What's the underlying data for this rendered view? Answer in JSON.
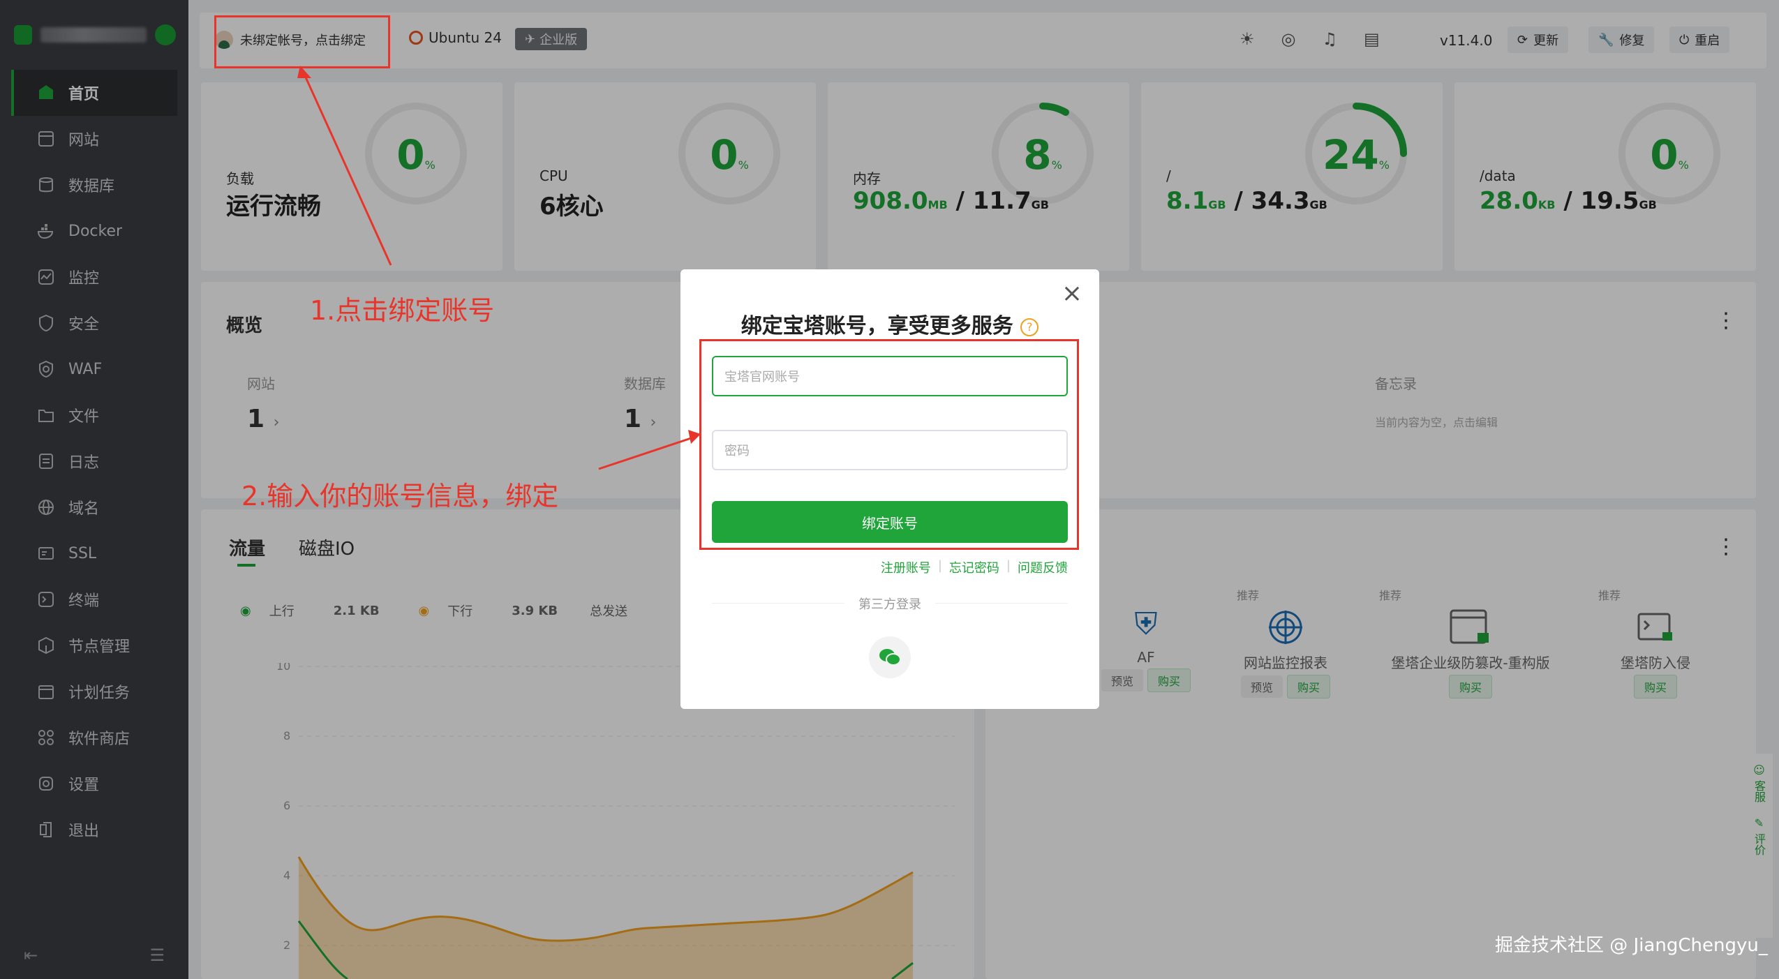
{
  "sidebar": {
    "items": [
      {
        "label": "首页",
        "icon": "home-icon"
      },
      {
        "label": "网站",
        "icon": "website-icon"
      },
      {
        "label": "数据库",
        "icon": "database-icon"
      },
      {
        "label": "Docker",
        "icon": "docker-icon"
      },
      {
        "label": "监控",
        "icon": "monitor-icon"
      },
      {
        "label": "安全",
        "icon": "shield-icon"
      },
      {
        "label": "WAF",
        "icon": "waf-icon"
      },
      {
        "label": "文件",
        "icon": "folder-icon"
      },
      {
        "label": "日志",
        "icon": "log-icon"
      },
      {
        "label": "域名",
        "icon": "globe-icon"
      },
      {
        "label": "SSL",
        "icon": "ssl-icon"
      },
      {
        "label": "终端",
        "icon": "terminal-icon"
      },
      {
        "label": "节点管理",
        "icon": "node-icon"
      },
      {
        "label": "计划任务",
        "icon": "calendar-icon"
      },
      {
        "label": "软件商店",
        "icon": "store-icon"
      },
      {
        "label": "设置",
        "icon": "gear-icon"
      },
      {
        "label": "退出",
        "icon": "logout-icon"
      }
    ]
  },
  "topbar": {
    "bind_tip": "未绑定帐号，点击绑定",
    "os": "Ubuntu 24",
    "edition": "企业版",
    "version": "v11.4.0",
    "update": "更新",
    "repair": "修复",
    "restart": "重启"
  },
  "stats": [
    {
      "label": "负载",
      "value": "运行流畅",
      "percent": "0"
    },
    {
      "label": "CPU",
      "value": "6核心",
      "percent": "0"
    },
    {
      "label": "内存",
      "used": "908.0",
      "used_unit": "MB",
      "total": "11.7",
      "total_unit": "GB",
      "percent": "8"
    },
    {
      "label": "/",
      "used": "8.1",
      "used_unit": "GB",
      "total": "34.3",
      "total_unit": "GB",
      "percent": "24"
    },
    {
      "label": "/data",
      "used": "28.0",
      "used_unit": "KB",
      "total": "19.5",
      "total_unit": "GB",
      "percent": "0"
    }
  ],
  "overview": {
    "title": "概览",
    "site_label": "网站",
    "site_count": "1",
    "db_label": "数据库",
    "db_count": "1",
    "memo_label": "备忘录",
    "memo_hint": "当前内容为空，点击编辑"
  },
  "traffic": {
    "tab1": "流量",
    "tab2": "磁盘IO",
    "up_label": "上行",
    "up_value": "2.1 KB",
    "down_label": "下行",
    "down_value": "3.9 KB",
    "total_send": "总发送",
    "y_ticks": [
      "10",
      "8",
      "6",
      "4",
      "2"
    ]
  },
  "apps": {
    "recommend": "推荐",
    "preview": "预览",
    "buy": "购买",
    "items": [
      "AF",
      "网站监控报表",
      "堡塔企业级防篡改-重构版",
      "堡塔防入侵"
    ]
  },
  "modal": {
    "title": "绑定宝塔账号，享受更多服务",
    "account_placeholder": "宝塔官网账号",
    "password_placeholder": "密码",
    "bind_button": "绑定账号",
    "link_register": "注册账号",
    "link_forgot": "忘记密码",
    "link_feedback": "问题反馈",
    "third_party": "第三方登录"
  },
  "annotations": {
    "step1": "1.点击绑定账号",
    "step2": "2.输入你的账号信息，绑定"
  },
  "side_float": {
    "service": "客服",
    "review": "评价"
  },
  "watermark": "掘金技术社区 @ JiangChengyu_",
  "colors": {
    "accent": "#20a53a",
    "annotation": "#e8352b",
    "sidebar": "#3a3d41"
  }
}
